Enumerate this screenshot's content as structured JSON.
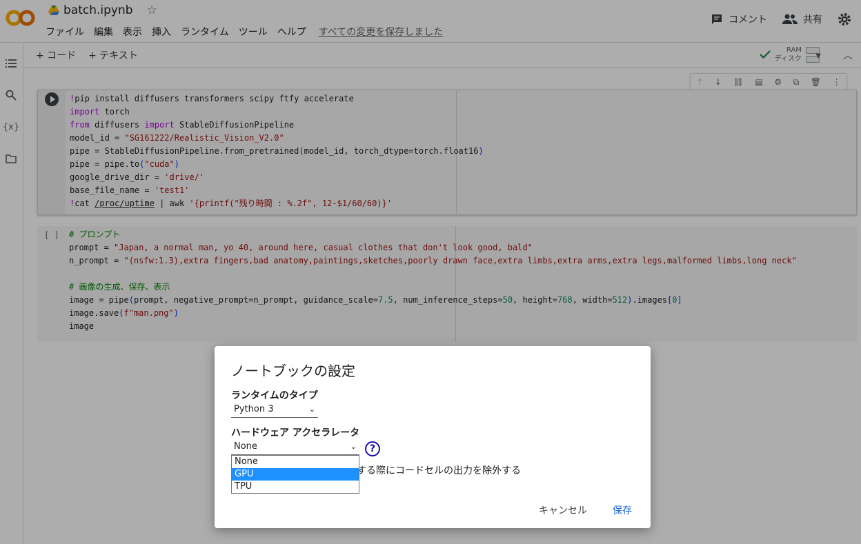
{
  "header": {
    "filename": "batch.ipynb",
    "menu": [
      "ファイル",
      "編集",
      "表示",
      "挿入",
      "ランタイム",
      "ツール",
      "ヘルプ"
    ],
    "saved_status": "すべての変更を保存しました",
    "comment_label": "コメント",
    "share_label": "共有"
  },
  "toolbar": {
    "add_code": "+ コード",
    "add_text": "+ テキスト",
    "ram_label": "RAM",
    "disk_label": "ディスク"
  },
  "cells": {
    "cell2_bracket": "[ ]"
  },
  "dialog": {
    "title": "ノートブックの設定",
    "runtime_label": "ランタイムのタイプ",
    "runtime_value": "Python 3",
    "hw_label": "ハードウェア アクセラレータ",
    "hw_value": "None",
    "help_icon": "question-circle-icon",
    "options": [
      "None",
      "GPU",
      "TPU"
    ],
    "highlighted_option": "GPU",
    "omit_text": "する際にコードセルの出力を除外する",
    "cancel_label": "キャンセル",
    "save_label": "保存"
  },
  "colors": {
    "accent": "#1967d2",
    "selected_option": "#1e90ff"
  }
}
